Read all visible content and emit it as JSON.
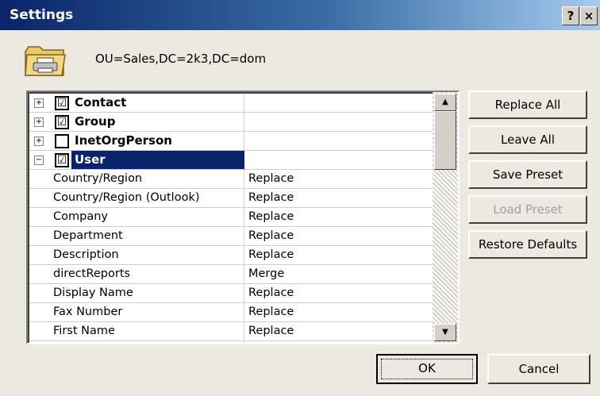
{
  "window": {
    "title": "Settings",
    "help_label": "?",
    "close_label": "×"
  },
  "header": {
    "ou_path": "OU=Sales,DC=2k3,DC=dom",
    "icon": "folder-printer-icon"
  },
  "grid": {
    "groups": [
      {
        "label": "Contact",
        "expander": "+",
        "checked": "☑",
        "selected": false
      },
      {
        "label": "Group",
        "expander": "+",
        "checked": "☑",
        "selected": false
      },
      {
        "label": "InetOrgPerson",
        "expander": "+",
        "checked": "",
        "selected": false
      },
      {
        "label": "User",
        "expander": "−",
        "checked": "☑",
        "selected": true
      }
    ],
    "attributes": [
      {
        "name": "Country/Region",
        "value": "Replace"
      },
      {
        "name": "Country/Region (Outlook)",
        "value": "Replace"
      },
      {
        "name": "Company",
        "value": "Replace"
      },
      {
        "name": "Department",
        "value": "Replace"
      },
      {
        "name": "Description",
        "value": "Replace"
      },
      {
        "name": "directReports",
        "value": "Merge"
      },
      {
        "name": "Display Name",
        "value": "Replace"
      },
      {
        "name": "Fax Number",
        "value": "Replace"
      },
      {
        "name": "First Name",
        "value": "Replace"
      }
    ],
    "scroll_up": "▲",
    "scroll_down": "▼"
  },
  "buttons": {
    "replace_all": "Replace All",
    "leave_all": "Leave All",
    "save_preset": "Save Preset",
    "load_preset": "Load Preset",
    "restore_defaults": "Restore Defaults",
    "ok": "OK",
    "cancel": "Cancel"
  }
}
